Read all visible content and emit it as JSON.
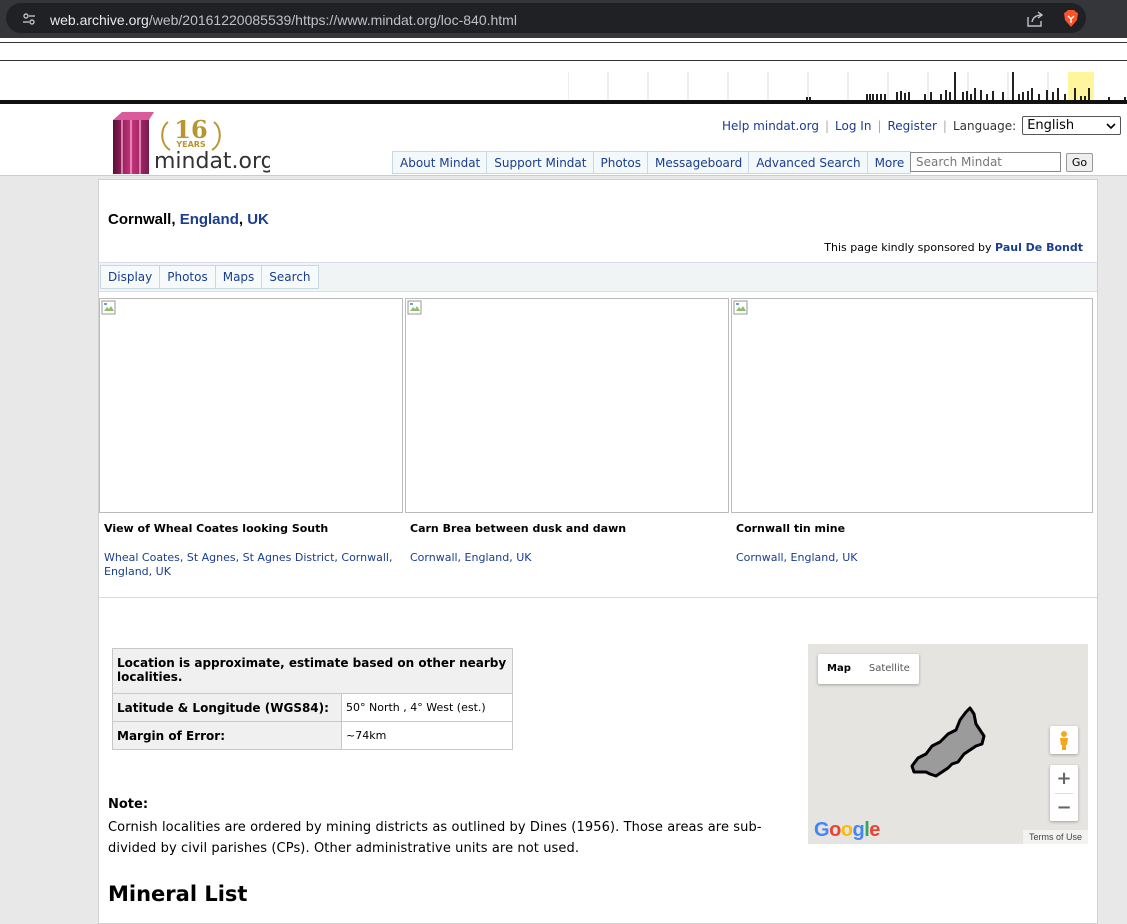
{
  "browser": {
    "url_host": "web.archive.org",
    "url_path": "/web/20161220085539/https://www.mindat.org/loc-840.html"
  },
  "header": {
    "logo_years": "16",
    "logo_years_word": "YEARS",
    "logo_text": "mindat.org",
    "help_link": "Help mindat.org",
    "login_link": "Log In",
    "register_link": "Register",
    "language_label": "Language:",
    "language_value": "English",
    "nav": [
      "About Mindat",
      "Support Mindat",
      "Photos",
      "Messageboard",
      "Advanced Search",
      "More"
    ],
    "search_placeholder": "Search Mindat",
    "go_label": "Go"
  },
  "page": {
    "title_plain": "Cornwall, ",
    "title_link1": "England",
    "title_sep": ", ",
    "title_link2": "UK",
    "sponsor_text": "This page kindly sponsored by ",
    "sponsor_name": "Paul De Bondt",
    "tabs": [
      "Display",
      "Photos",
      "Maps",
      "Search"
    ]
  },
  "photos": [
    {
      "caption": "View of Wheal Coates looking South",
      "location": "Wheal Coates, St Agnes, St Agnes District, Cornwall, England, UK"
    },
    {
      "caption": "Carn Brea between dusk and dawn",
      "location": "Cornwall, England, UK"
    },
    {
      "caption": "Cornwall tin mine",
      "location": "Cornwall, England, UK"
    }
  ],
  "location": {
    "header": "Location is approximate, estimate based on other nearby localities.",
    "latlong_label": "Latitude & Longitude (WGS84):",
    "latlong_value": "50° North , 4° West (est.)",
    "margin_label": "Margin of Error:",
    "margin_value": "~74km"
  },
  "note": {
    "label": "Note:",
    "text": "Cornish localities are ordered by mining districts as outlined by Dines (1956). Those areas are sub-divided by civil parishes (CPs). Other administrative units are not used."
  },
  "mineral_list_heading": "Mineral List",
  "map": {
    "tab_map": "Map",
    "tab_satellite": "Satellite",
    "zoom_in": "+",
    "zoom_out": "−",
    "terms": "Terms of Use",
    "google_letters": [
      "G",
      "o",
      "o",
      "g",
      "l",
      "e"
    ],
    "google_colors": [
      "#4285f4",
      "#ea4335",
      "#fbbc05",
      "#4285f4",
      "#34a853",
      "#ea4335"
    ]
  }
}
